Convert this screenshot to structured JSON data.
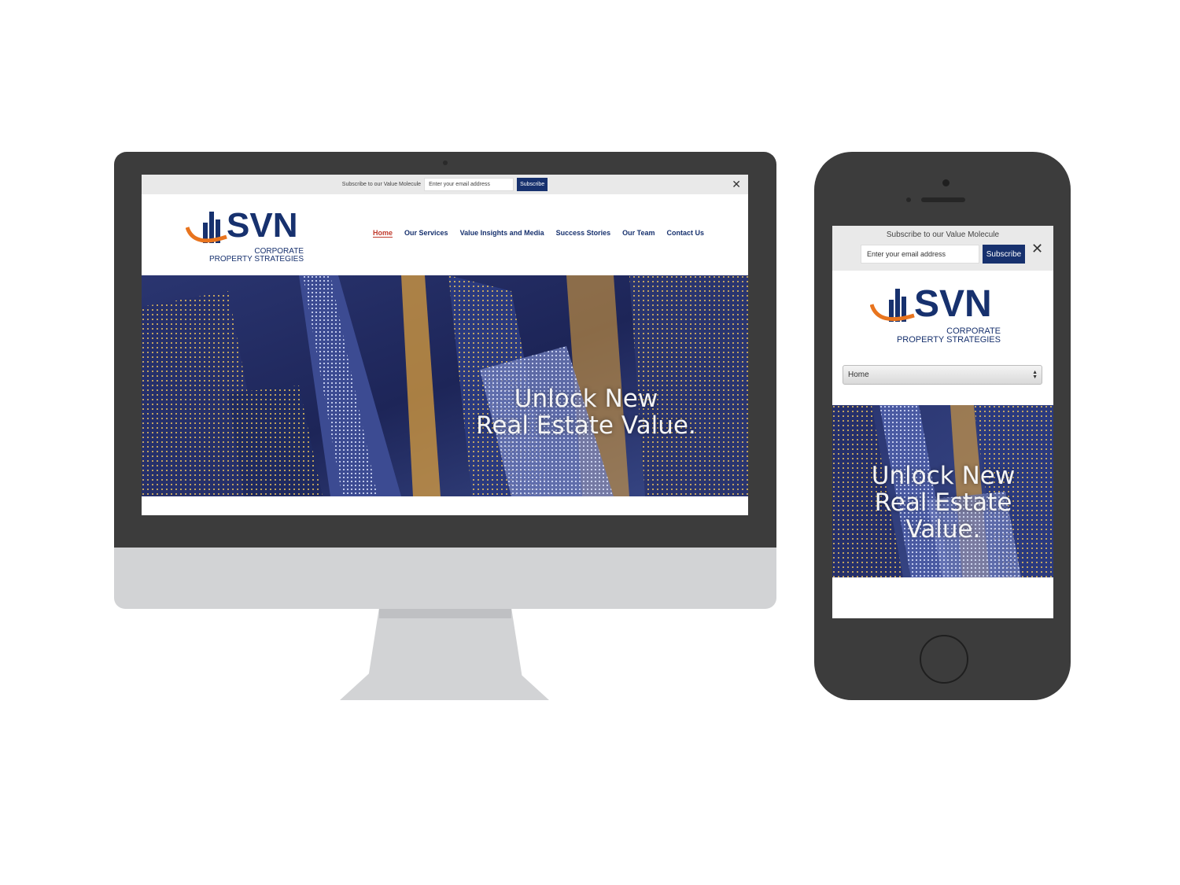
{
  "desktop": {
    "subscribe": {
      "label": "Subscribe to our Value Molecule",
      "placeholder": "Enter your email address",
      "button": "Subscribe",
      "close": "✕"
    },
    "logo": {
      "brand": "SVN",
      "line1": "CORPORATE",
      "line2": "PROPERTY STRATEGIES"
    },
    "nav": [
      {
        "label": "Home",
        "active": true
      },
      {
        "label": "Our Services"
      },
      {
        "label": "Value Insights and Media"
      },
      {
        "label": "Success Stories"
      },
      {
        "label": "Our Team"
      },
      {
        "label": "Contact Us"
      }
    ],
    "hero": {
      "line1": "Unlock New",
      "line2": "Real Estate Value."
    }
  },
  "mobile": {
    "subscribe": {
      "label": "Subscribe to our Value Molecule",
      "placeholder": "Enter your email address",
      "button": "Subscribe",
      "close": "✕"
    },
    "logo": {
      "brand": "SVN",
      "line1": "CORPORATE",
      "line2": "PROPERTY STRATEGIES"
    },
    "menu_select": "Home",
    "hero": {
      "line1": "Unlock New",
      "line2": "Real Estate",
      "line3": "Value."
    }
  },
  "colors": {
    "brand_navy": "#17316e",
    "brand_orange": "#e8741e",
    "active_nav": "#c0392b",
    "device_body": "#3c3c3c",
    "device_silver": "#d2d3d5"
  }
}
